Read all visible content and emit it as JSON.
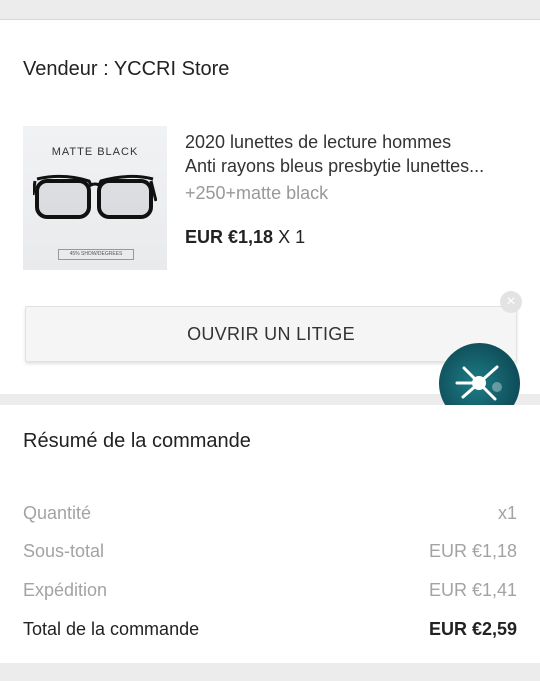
{
  "seller": "Vendeur : YCCRI Store",
  "product": {
    "image_label": "MATTE BLACK",
    "image_tag": "45% SHOW/DEGREES",
    "title_line1": "2020 lunettes de lecture hommes",
    "title_line2": "Anti rayons bleus presbytie lunettes...",
    "variant": "+250+matte black",
    "price": "EUR €1,18",
    "qty": " X 1"
  },
  "dispute_button": "OUVRIR UN LITIGE",
  "close_icon": "×",
  "summary": {
    "title": "Résumé de la commande",
    "rows": [
      {
        "label": "Quantité",
        "value": "x1"
      },
      {
        "label": "Sous-total",
        "value": "EUR €1,18"
      },
      {
        "label": "Expédition",
        "value": "EUR €1,41"
      },
      {
        "label": "Total de la commande",
        "value": "EUR €2,59"
      }
    ]
  },
  "colors": {
    "fab": "#0f4e5a",
    "muted_text": "#a3a3a3"
  }
}
